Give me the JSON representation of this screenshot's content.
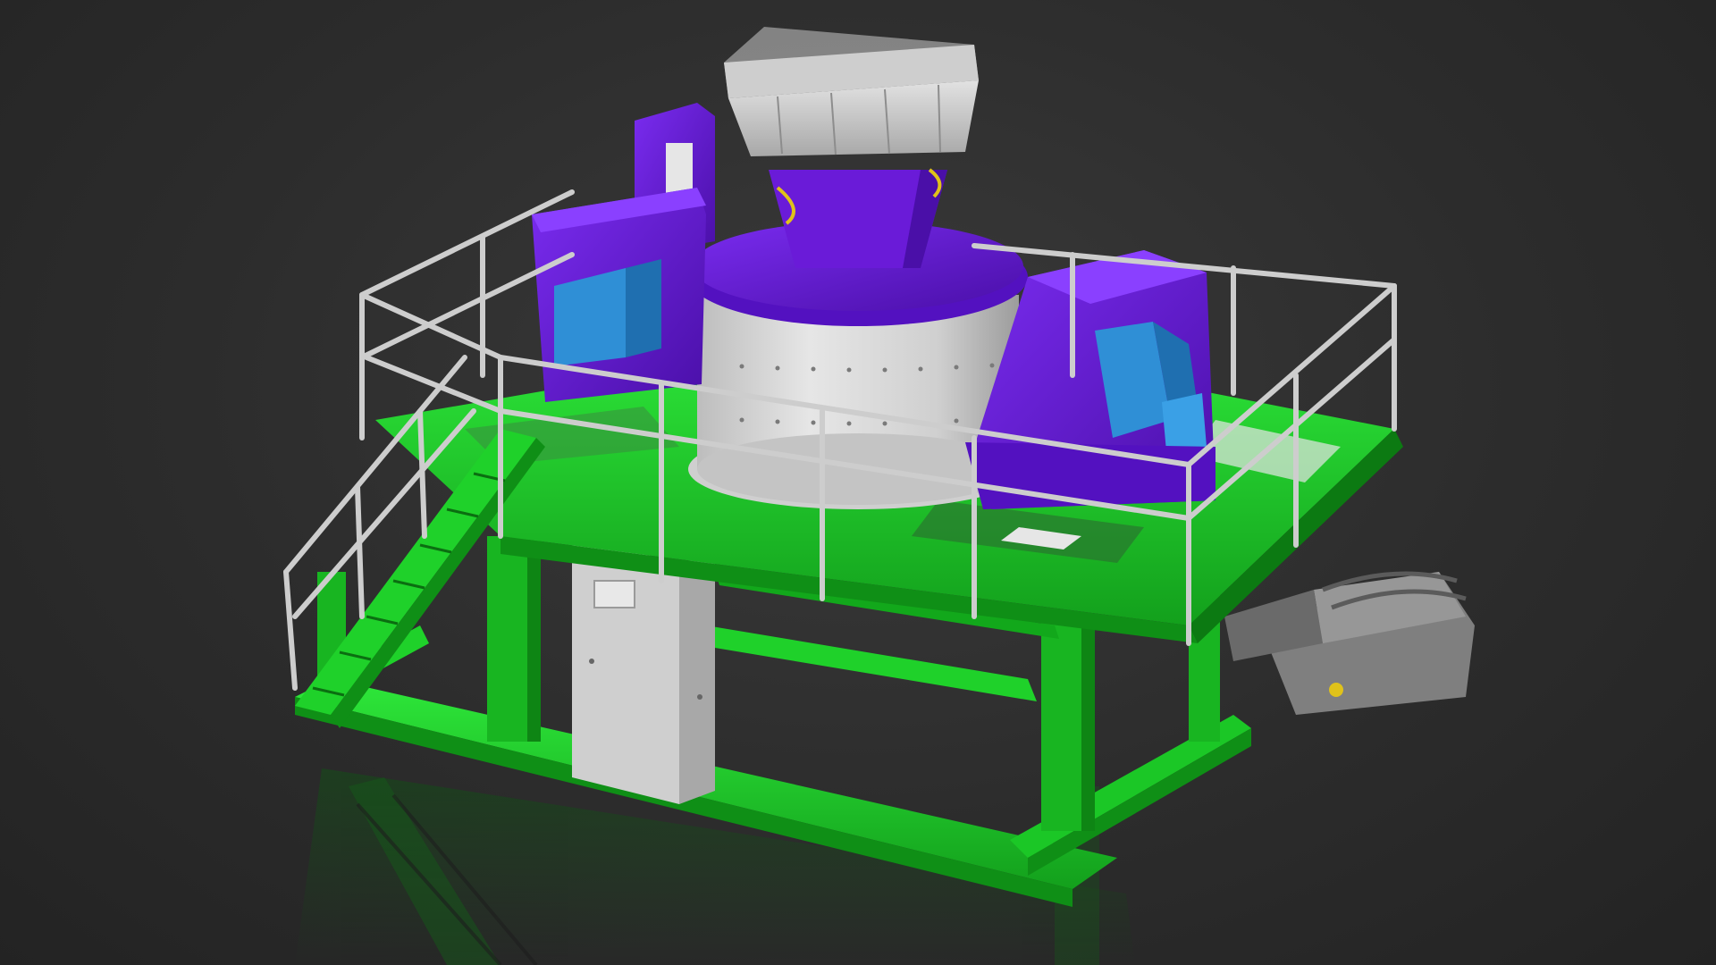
{
  "scene": {
    "subject": "",
    "background_color": "#2e2e2e",
    "colors": {
      "frame": "#1fd12a",
      "frame_dark": "#0f8f16",
      "housing": "#6a1bd8",
      "housing_dark": "#4a0fa8",
      "drum": "#d6d6d6",
      "drum_shade": "#a9a9a9",
      "motor": "#2f8fd6",
      "rail": "#c9c9c9",
      "conveyor": "#7d7d7d"
    }
  }
}
